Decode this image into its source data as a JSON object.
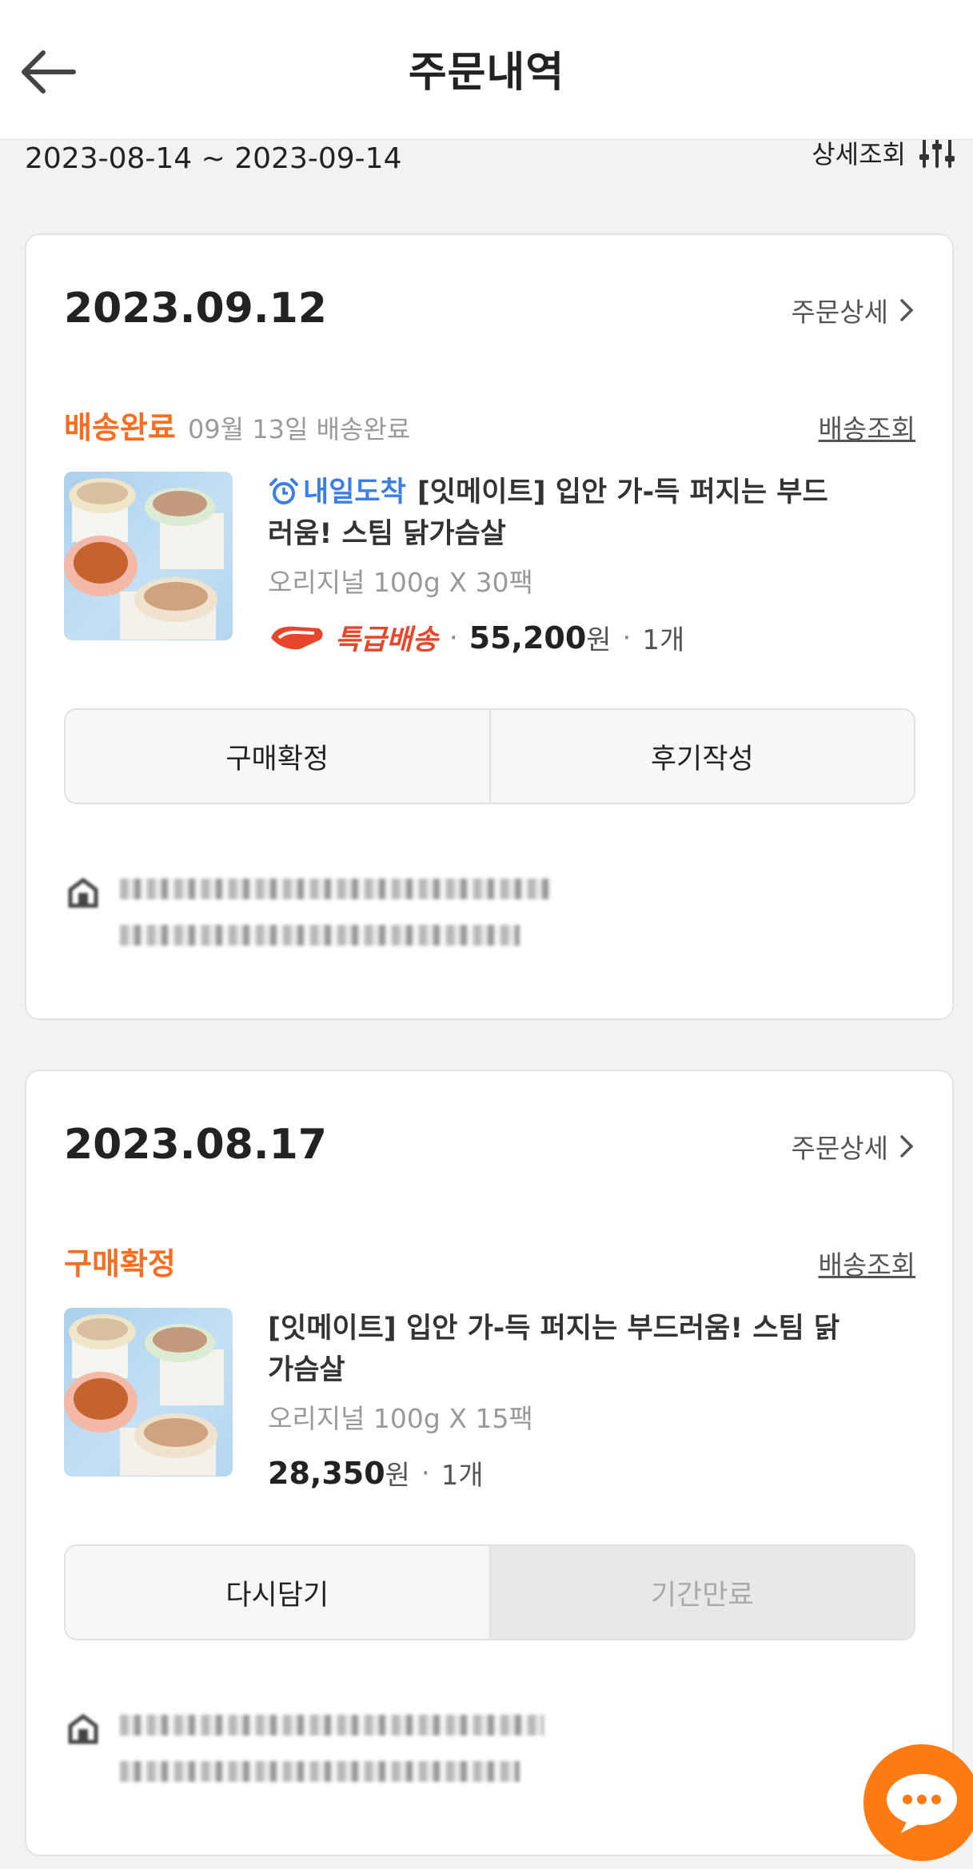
{
  "header": {
    "title": "주문내역"
  },
  "filter": {
    "date_range": "2023-08-14 ~ 2023-09-14",
    "detail_search_label": "상세조회"
  },
  "orders": [
    {
      "date": "2023.09.12",
      "detail_label": "주문상세",
      "status": "배송완료",
      "status_sub": "09월 13일 배송완료",
      "tracking_label": "배송조회",
      "delivery_badge": "내일도착",
      "product_name": "[잇메이트] 입안 가-득 퍼지는 부드러움! 스팀 닭가슴살",
      "option": "오리지널 100g X 30팩",
      "shipping_tag": "특급배송",
      "price": "55,200",
      "currency": "원",
      "quantity": "1개",
      "buttons": [
        "구매확정",
        "후기작성"
      ]
    },
    {
      "date": "2023.08.17",
      "detail_label": "주문상세",
      "status": "구매확정",
      "tracking_label": "배송조회",
      "product_name": "[잇메이트] 입안 가-득 퍼지는 부드러움! 스팀 닭가슴살",
      "option": "오리지널 100g X 15팩",
      "price": "28,350",
      "currency": "원",
      "quantity": "1개",
      "buttons": [
        "다시담기",
        "기간만료"
      ]
    }
  ],
  "colors": {
    "accent": "#fa6d1e",
    "tomorrow": "#3a7ee8",
    "express": "#e8462a",
    "fab": "#ff7a12"
  },
  "icons": [
    "back-arrow-icon",
    "filter-sliders-icon",
    "chevron-right-icon",
    "alarm-clock-icon",
    "express-shipping-icon",
    "store-icon",
    "chat-bubble-icon"
  ]
}
